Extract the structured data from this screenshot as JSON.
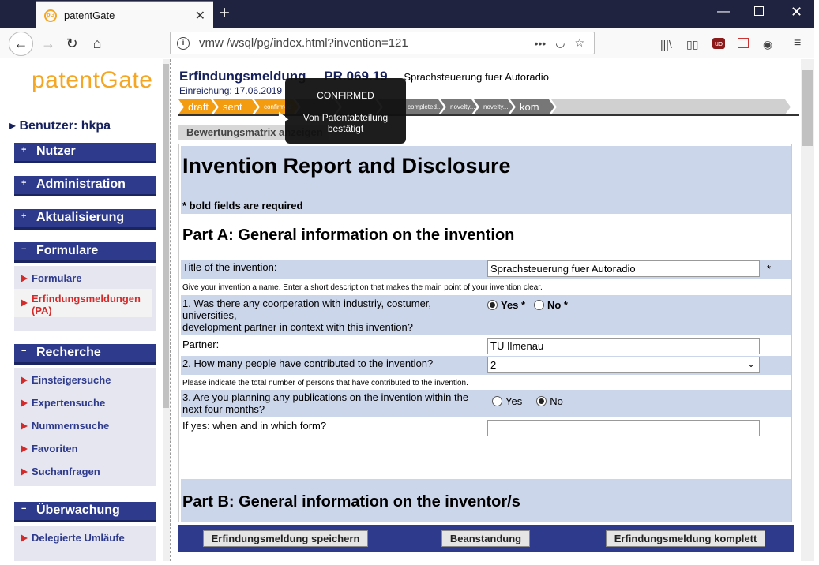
{
  "browser": {
    "tab_title": "patentGate",
    "url": "vmw       /wsql/pg/index.html?invention=121",
    "favicon_text": "pG"
  },
  "sidebar": {
    "logo": "patentGate",
    "user_label": "Benutzer: hkpa",
    "sections": [
      {
        "label": "Nutzer",
        "expanded": false
      },
      {
        "label": "Administration",
        "expanded": false
      },
      {
        "label": "Aktualisierung",
        "expanded": false
      },
      {
        "label": "Formulare",
        "expanded": true,
        "items": [
          "Formulare",
          "Erfindungsmeldungen (PA)"
        ]
      },
      {
        "label": "Recherche",
        "expanded": true,
        "items": [
          "Einsteigersuche",
          "Expertensuche",
          "Nummernsuche",
          "Favoriten",
          "Suchanfragen"
        ]
      },
      {
        "label": "Überwachung",
        "expanded": true,
        "items": [
          "Delegierte Umläufe"
        ]
      }
    ]
  },
  "form": {
    "title": "Erfindungsmeldung",
    "id": "PR.069.19",
    "subject": "Sprachsteuerung fuer Autoradio",
    "einreichung": "Einreichung: 17.06.2019",
    "steps": [
      "draft",
      "sent",
      "confirmed",
      "",
      "",
      "",
      "completed...",
      "novelty...",
      "novelty...",
      "kom"
    ],
    "bewertung_tab": "Bewertungsmatrix anzeigen",
    "doc_title": "Invention Report and Disclosure",
    "required_note": "* bold fields are required",
    "part_a": "Part A: General information on the invention",
    "title_label": "Title of the invention:",
    "title_value": "Sprachsteuerung fuer Autoradio",
    "title_star": "*",
    "title_hint": "Give your invention a name. Enter a short description that makes the main point of your invention clear.",
    "q1": "1. Was there any coorperation with industriy, costumer, universities,",
    "q1b": "development partner in context with this invention?",
    "yes_star": "Yes *",
    "no_star": "No *",
    "partner_label": "Partner:",
    "partner_value": "TU Ilmenau",
    "q2": "2. How many people have contributed to the invention?",
    "q2_value": "2",
    "q2_hint": "Please indicate the total number of persons that have contributed to the invention.",
    "q3": "3. Are you planning any publications on the invention within the",
    "q3b": "next four months?",
    "yes": "Yes",
    "no": "No",
    "ifyes_label": "If yes: when and in which form?",
    "ifyes_value": "",
    "part_b": "Part B: General information on the inventor/s"
  },
  "buttons": {
    "save": "Erfindungsmeldung speichern",
    "objection": "Beanstandung",
    "complete": "Erfindungsmeldung komplett"
  },
  "tooltip": {
    "title": "CONFIRMED",
    "text": "Von Patentabteilung bestätigt"
  },
  "colors": {
    "accent_orange": "#f39c12",
    "nav_blue": "#2e3a8c",
    "band_blue": "#ccd6ea",
    "link_red": "#d42a2a"
  }
}
